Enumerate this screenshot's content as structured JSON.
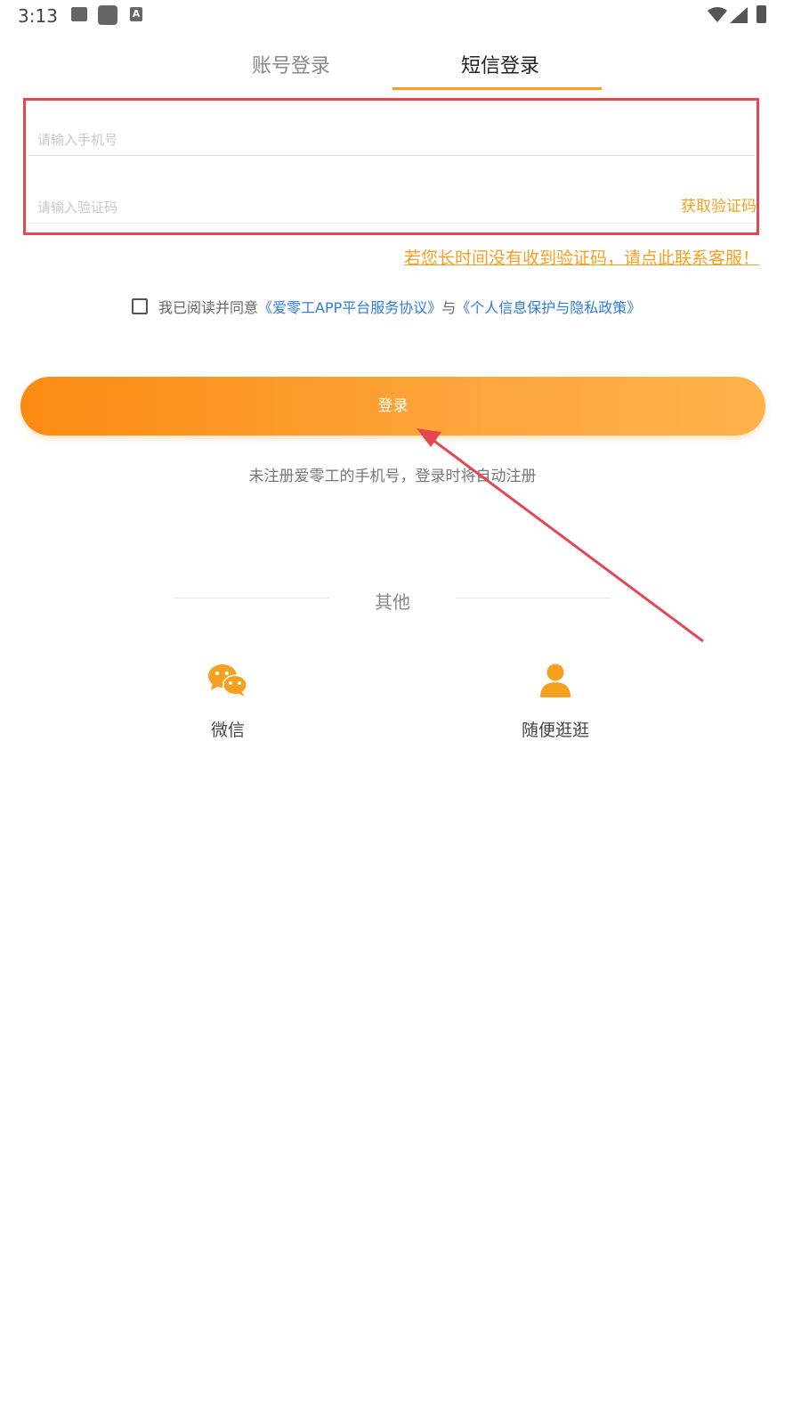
{
  "status_bar": {
    "time": "3:13",
    "icons": [
      "image-icon",
      "square-icon",
      "a-icon",
      "wifi-icon",
      "signal-icon",
      "battery-icon"
    ],
    "a_glyph": "A"
  },
  "tabs": [
    {
      "label": "账号登录",
      "active": false
    },
    {
      "label": "短信登录",
      "active": true
    }
  ],
  "form": {
    "phone_placeholder": "请输入手机号",
    "code_placeholder": "请输入验证码",
    "get_code_label": "获取验证码"
  },
  "support_link": "若您长时间没有收到验证码，请点此联系客服！",
  "agreement": {
    "prefix": "我已阅读并同意",
    "link1": "《爱零工APP平台服务协议》",
    "and": "与",
    "link2": "《个人信息保护与隐私政策》"
  },
  "login_button": "登录",
  "note": "未注册爱零工的手机号，登录时将自动注册",
  "other": {
    "label": "其他",
    "options": [
      {
        "label": "微信",
        "icon": "wechat-icon"
      },
      {
        "label": "随便逛逛",
        "icon": "person-icon"
      }
    ]
  },
  "colors": {
    "accent": "#f6a022",
    "link": "#2f7bd6",
    "highlight_box": "#e34850"
  }
}
